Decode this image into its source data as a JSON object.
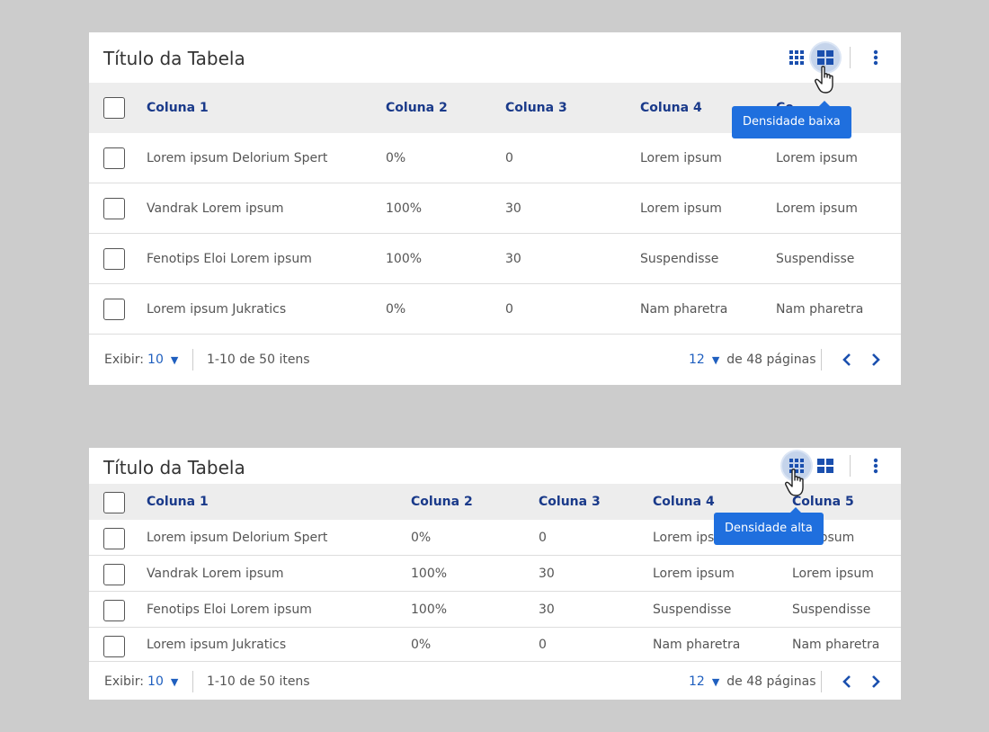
{
  "colors": {
    "accent": "#1f6fde",
    "header_bg": "#ededed",
    "page_bg": "#cccccc"
  },
  "tables": [
    {
      "title": "Título da Tabela",
      "density": "low",
      "tooltip": "Densidade baixa",
      "columns": [
        "Coluna 1",
        "Coluna 2",
        "Coluna 3",
        "Coluna 4",
        "Co"
      ],
      "rows": [
        [
          "Lorem ipsum Delorium Spert",
          "0%",
          "0",
          "Lorem ipsum",
          "Lorem ipsum"
        ],
        [
          "Vandrak Lorem ipsum",
          "100%",
          "30",
          "Lorem ipsum",
          "Lorem ipsum"
        ],
        [
          "Fenotips Eloi Lorem ipsum",
          "100%",
          "30",
          "Suspendisse",
          "Suspendisse"
        ],
        [
          "Lorem ipsum Jukratics",
          "0%",
          "0",
          "Nam pharetra",
          "Nam pharetra"
        ]
      ],
      "footer": {
        "show_label": "Exibir:",
        "show_value": "10",
        "items_range": "1-10 de 50 itens",
        "page_value": "12",
        "pages_label": "de 48 páginas"
      }
    },
    {
      "title": "Título da Tabela",
      "density": "high",
      "tooltip": "Densidade alta",
      "columns": [
        "Coluna 1",
        "Coluna 2",
        "Coluna 3",
        "Coluna 4",
        "Coluna 5"
      ],
      "rows": [
        [
          "Lorem ipsum Delorium Spert",
          "0%",
          "0",
          "Lorem ipsu",
          "em ipsum"
        ],
        [
          "Vandrak Lorem ipsum",
          "100%",
          "30",
          "Lorem ipsum",
          "Lorem ipsum"
        ],
        [
          "Fenotips Eloi Lorem ipsum",
          "100%",
          "30",
          "Suspendisse",
          "Suspendisse"
        ],
        [
          "Lorem ipsum Jukratics",
          "0%",
          "0",
          "Nam pharetra",
          "Nam pharetra"
        ]
      ],
      "footer": {
        "show_label": "Exibir:",
        "show_value": "10",
        "items_range": "1-10 de 50 itens",
        "page_value": "12",
        "pages_label": "de 48 páginas"
      }
    }
  ]
}
